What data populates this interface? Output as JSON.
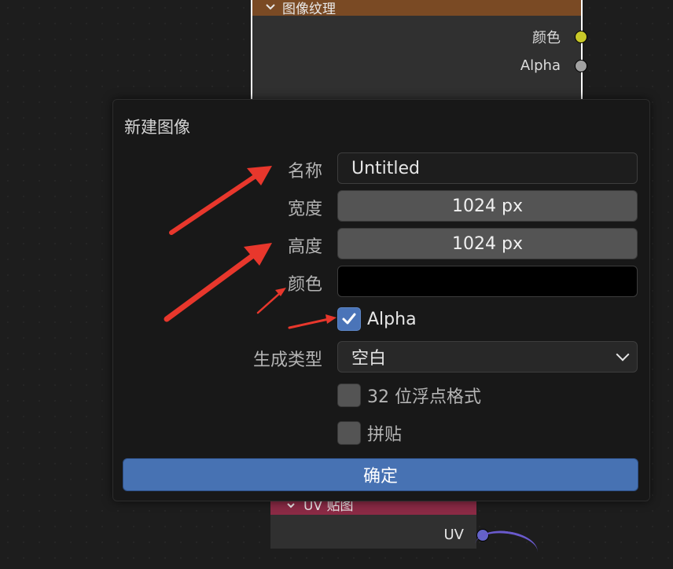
{
  "node_image": {
    "title": "图像纹理",
    "sockets": [
      "颜色",
      "Alpha"
    ]
  },
  "node_uv": {
    "title": "UV 贴图",
    "socket": "UV"
  },
  "dialog": {
    "title": "新建图像",
    "name_label": "名称",
    "name_value": "Untitled",
    "width_label": "宽度",
    "width_value": "1024 px",
    "height_label": "高度",
    "height_value": "1024 px",
    "color_label": "颜色",
    "color_value": "#000000",
    "alpha_label": "Alpha",
    "alpha_checked": true,
    "gen_type_label": "生成类型",
    "gen_type_value": "空白",
    "float_label": "32 位浮点格式",
    "float_checked": false,
    "tiled_label": "拼贴",
    "tiled_checked": false,
    "ok_label": "确定"
  },
  "colors": {
    "accent": "#4772b3",
    "annotation_arrow": "#e8372c",
    "image_node_header": "#7a4a24",
    "uv_node_header": "#8a2a45"
  },
  "icons": [
    "chevron-down-icon",
    "check-icon",
    "socket-dot-icon",
    "annotation-arrow-icon"
  ]
}
